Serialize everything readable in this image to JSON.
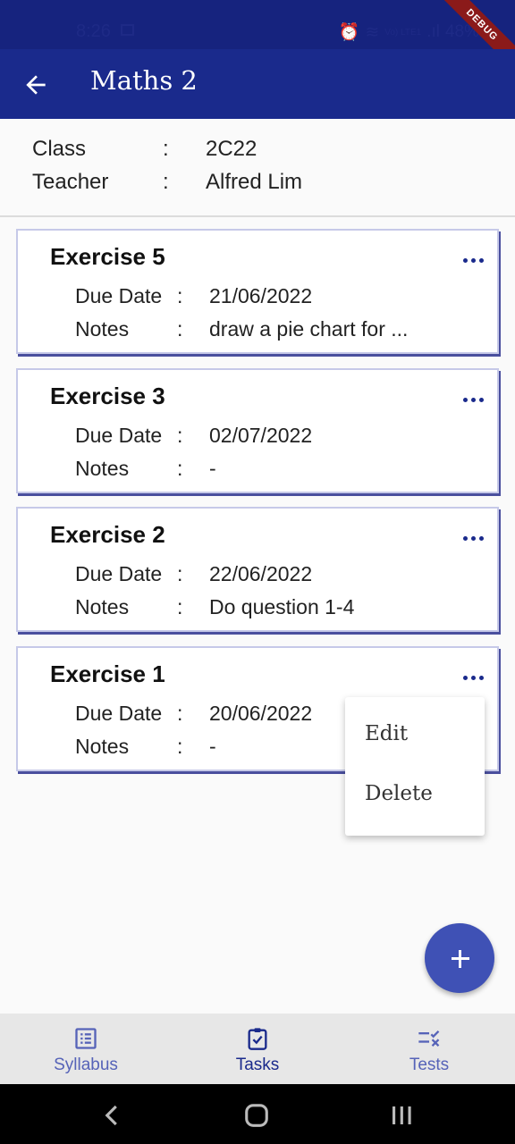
{
  "status_bar": {
    "time": "8:26",
    "battery": "48%",
    "network": "Vo) LTE1",
    "debug_label": "DEBUG"
  },
  "app_bar": {
    "title": "Maths 2"
  },
  "info": {
    "class_label": "Class",
    "class_value": "2C22",
    "teacher_label": "Teacher",
    "teacher_value": "Alfred Lim",
    "separator": ":"
  },
  "labels": {
    "due_date": "Due Date",
    "notes": "Notes",
    "separator": ":"
  },
  "exercises": [
    {
      "title": "Exercise 5",
      "due_date": "21/06/2022",
      "notes": "draw a pie chart for ..."
    },
    {
      "title": "Exercise 3",
      "due_date": "02/07/2022",
      "notes": "-"
    },
    {
      "title": "Exercise 2",
      "due_date": "22/06/2022",
      "notes": "Do question 1-4"
    },
    {
      "title": "Exercise 1",
      "due_date": "20/06/2022",
      "notes": "-"
    }
  ],
  "popup_menu": {
    "items": [
      "Edit",
      "Delete"
    ]
  },
  "bottom_nav": {
    "items": [
      {
        "label": "Syllabus",
        "icon": "syllabus-icon"
      },
      {
        "label": "Tasks",
        "icon": "tasks-icon",
        "active": true
      },
      {
        "label": "Tests",
        "icon": "tests-icon"
      }
    ]
  },
  "colors": {
    "primary": "#1a2a8c",
    "fab": "#3f51b5",
    "background": "#fafafa"
  }
}
